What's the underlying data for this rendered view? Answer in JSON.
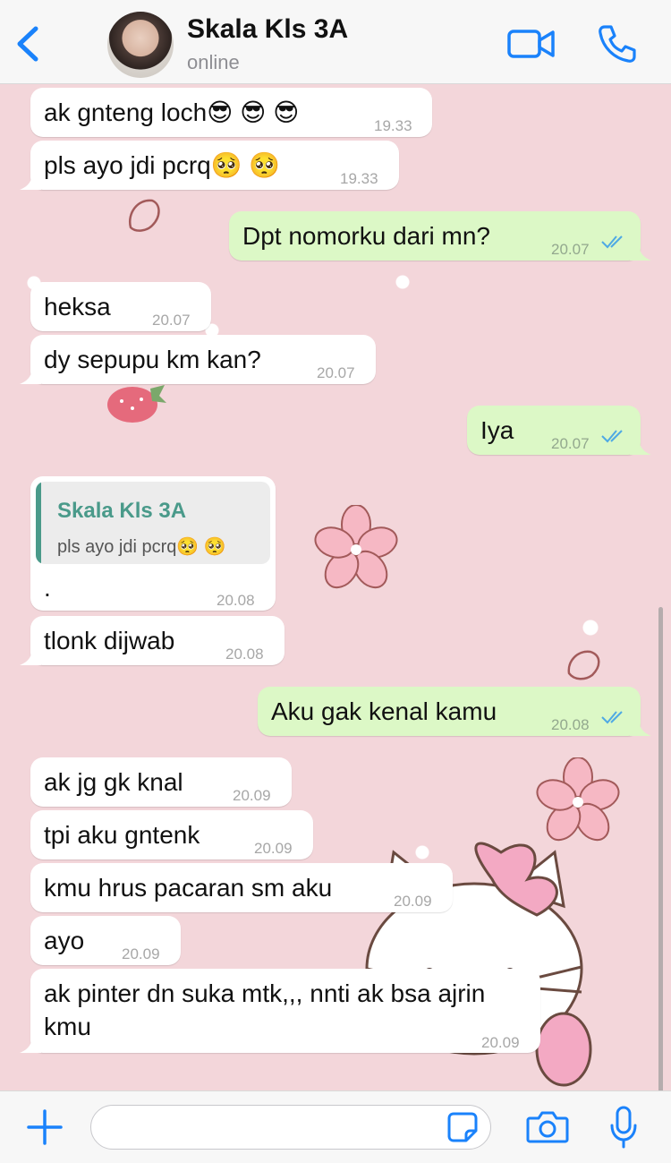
{
  "header": {
    "contact_name": "Skala Kls 3A",
    "status": "online",
    "back_icon": "chevron-left-icon",
    "video_icon": "video-camera-icon",
    "call_icon": "phone-icon"
  },
  "colors": {
    "accent": "#1a82fb",
    "incoming_bubble": "#ffffff",
    "outgoing_bubble": "#dcf8c6",
    "quote_accent": "#4a9a8a",
    "read_ticks": "#4fa9e4",
    "wallpaper": "#f3d6da"
  },
  "messages": [
    {
      "dir": "in",
      "text": "ak gnteng loch😎 😎 😎",
      "time": "19.33"
    },
    {
      "dir": "in",
      "text": "pls ayo jdi pcrq🥺 🥺",
      "time": "19.33"
    },
    {
      "dir": "out",
      "text": "Dpt nomorku dari mn?",
      "time": "20.07",
      "read": true
    },
    {
      "dir": "in",
      "text": "heksa",
      "time": "20.07"
    },
    {
      "dir": "in",
      "text": "dy sepupu km kan?",
      "time": "20.07"
    },
    {
      "dir": "out",
      "text": "Iya",
      "time": "20.07",
      "read": true
    },
    {
      "dir": "in",
      "text": ".",
      "time": "20.08",
      "quote": {
        "name": "Skala Kls 3A",
        "text": "pls ayo jdi pcrq🥺 🥺"
      }
    },
    {
      "dir": "in",
      "text": "tlonk dijwab",
      "time": "20.08"
    },
    {
      "dir": "out",
      "text": "Aku gak kenal kamu",
      "time": "20.08",
      "read": true
    },
    {
      "dir": "in",
      "text": "ak jg gk knal",
      "time": "20.09"
    },
    {
      "dir": "in",
      "text": "tpi aku gntenk",
      "time": "20.09"
    },
    {
      "dir": "in",
      "text": "kmu hrus pacaran sm aku",
      "time": "20.09"
    },
    {
      "dir": "in",
      "text": "ayo",
      "time": "20.09"
    },
    {
      "dir": "in",
      "text_line1": "ak pinter dn suka mtk,,, nnti ak bsa ajrin",
      "text_line2": "kmu",
      "time": "20.09"
    }
  ],
  "input": {
    "placeholder": "",
    "value": "",
    "plus_icon": "plus-icon",
    "sticker_icon": "sticker-icon",
    "camera_icon": "camera-icon",
    "mic_icon": "microphone-icon"
  }
}
